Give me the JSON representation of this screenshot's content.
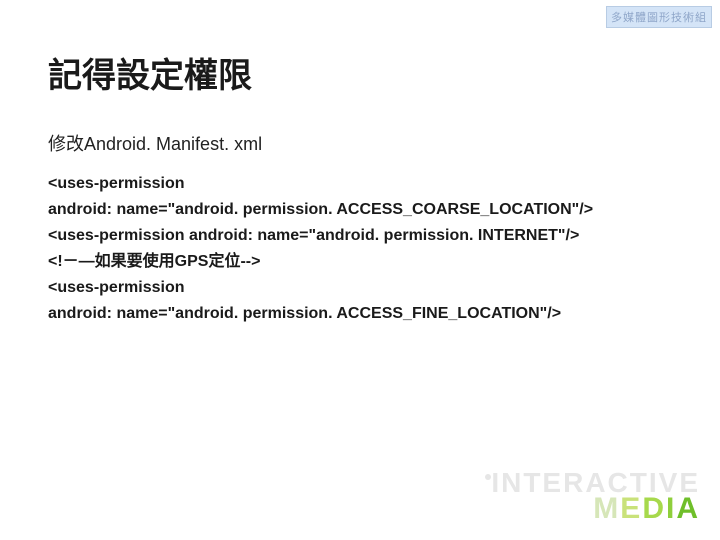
{
  "badge": "多媒體圖形技術組",
  "title": "記得設定權限",
  "subtitle": "修改Android. Manifest. xml",
  "code": {
    "l1a": "<uses-permission",
    "l1b": "android: name=\"android. permission. ACCESS_COARSE_LOCATION\"/>",
    "l2": "<uses-permission android: name=\"android. permission. INTERNET\"/>",
    "l3": "<!－—如果要使用GPS定位-->",
    "l4a": "<uses-permission",
    "l4b": "android: name=\"android. permission. ACCESS_FINE_LOCATION\"/>"
  },
  "footer": {
    "word1": "INTERACTIVE",
    "word2": "MEDIA"
  }
}
